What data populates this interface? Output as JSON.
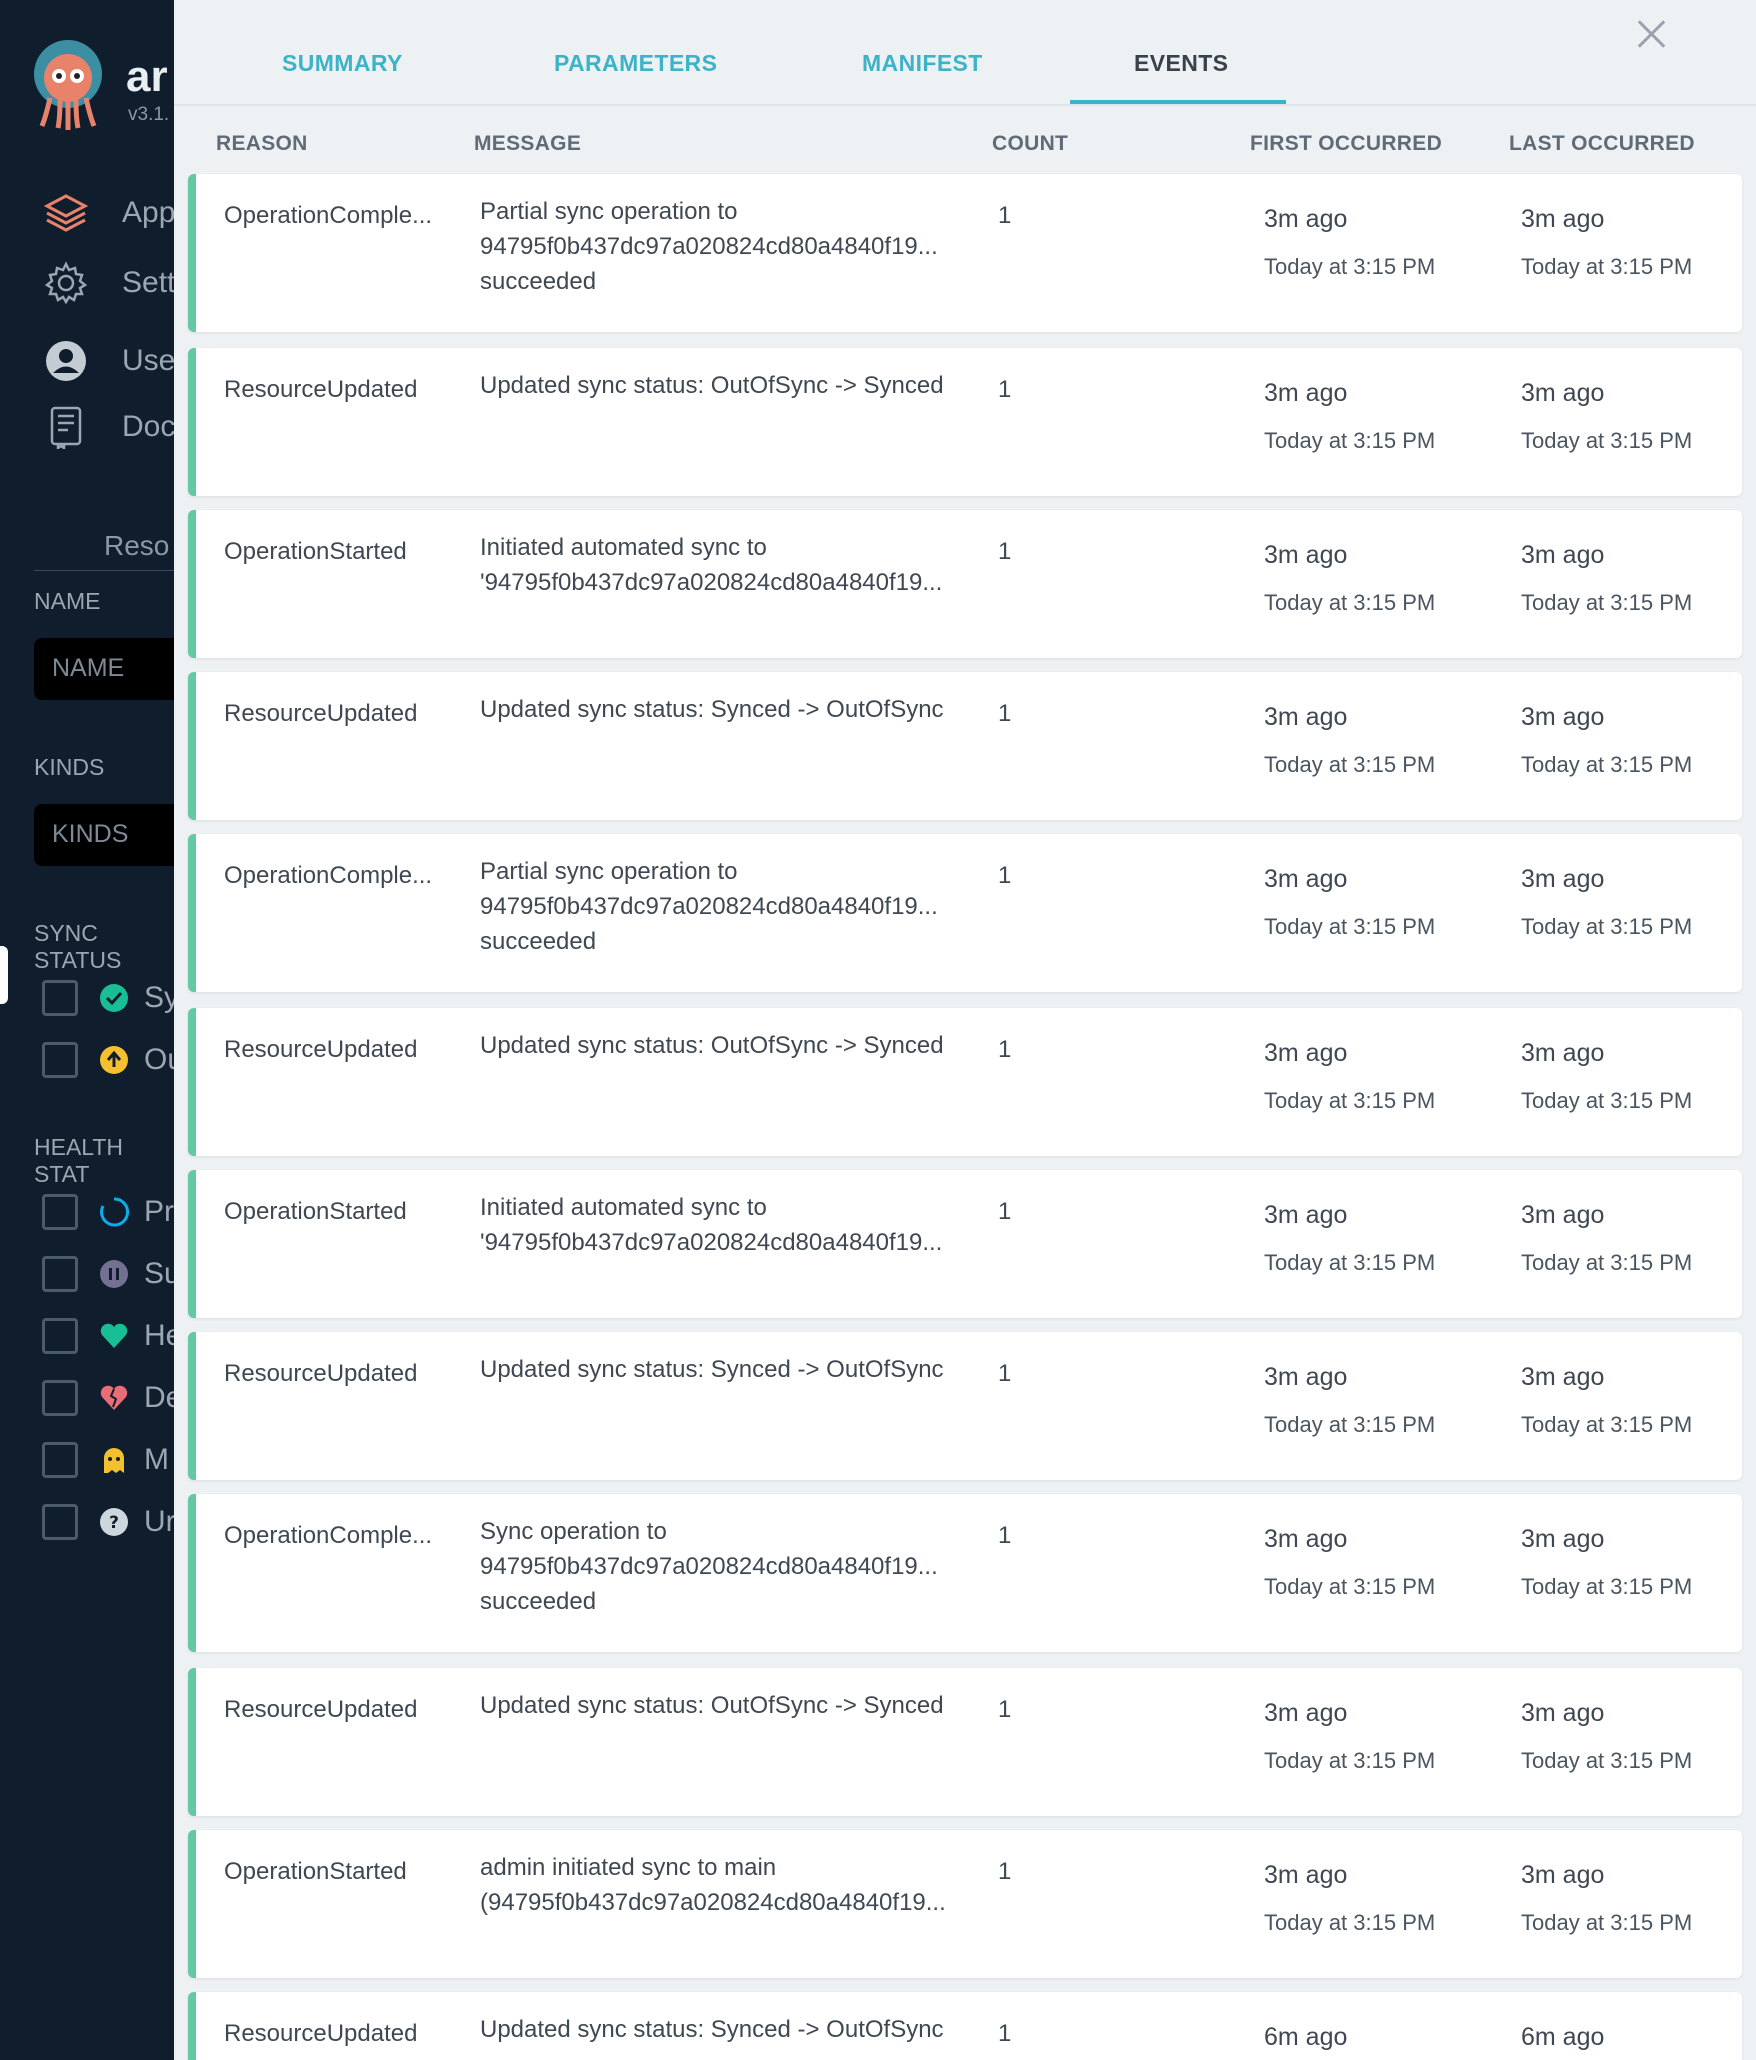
{
  "sidebar": {
    "brand": "ar",
    "version": "v3.1.",
    "nav": [
      {
        "label": "App",
        "icon": "layers-icon"
      },
      {
        "label": "Sett",
        "icon": "gear-icon"
      },
      {
        "label": "Use",
        "icon": "user-icon"
      },
      {
        "label": "Doc",
        "icon": "book-icon"
      }
    ],
    "filters_title": "Reso",
    "name_label": "NAME",
    "name_placeholder": "NAME",
    "kinds_label": "KINDS",
    "kinds_placeholder": "KINDS",
    "sync_status_label": "SYNC STATUS",
    "sync_items": [
      {
        "text": "Sy",
        "icon": "check-circle-icon",
        "color": "#18be94"
      },
      {
        "text": "Ou",
        "icon": "arrow-up-circle-icon",
        "color": "#f4c030"
      }
    ],
    "health_status_label": "HEALTH STAT",
    "health_items": [
      {
        "text": "Pr",
        "icon": "progress-circle-icon",
        "color": "#0dadea"
      },
      {
        "text": "Su",
        "icon": "pause-circle-icon",
        "color": "#766f94"
      },
      {
        "text": "He",
        "icon": "heart-icon",
        "color": "#18be94"
      },
      {
        "text": "De",
        "icon": "broken-heart-icon",
        "color": "#e96d76"
      },
      {
        "text": "M",
        "icon": "ghost-icon",
        "color": "#f4c030"
      },
      {
        "text": "Ur",
        "icon": "question-circle-icon",
        "color": "#ccd6dd"
      }
    ]
  },
  "tabs": {
    "summary": "SUMMARY",
    "parameters": "PARAMETERS",
    "manifest": "MANIFEST",
    "events": "EVENTS"
  },
  "columns": {
    "reason": "REASON",
    "message": "MESSAGE",
    "count": "COUNT",
    "first": "FIRST OCCURRED",
    "last": "LAST OCCURRED"
  },
  "events": [
    {
      "reason": "OperationComple...",
      "message": [
        "Partial sync operation to",
        "94795f0b437dc97a020824cd80a4840f19...",
        "succeeded"
      ],
      "count": "1",
      "first_ago": "3m ago",
      "first_at": "Today at 3:15 PM",
      "last_ago": "3m ago",
      "last_at": "Today at 3:15 PM"
    },
    {
      "reason": "ResourceUpdated",
      "message": [
        "Updated sync status: OutOfSync -> Synced"
      ],
      "count": "1",
      "first_ago": "3m ago",
      "first_at": "Today at 3:15 PM",
      "last_ago": "3m ago",
      "last_at": "Today at 3:15 PM"
    },
    {
      "reason": "OperationStarted",
      "message": [
        "Initiated automated sync to",
        "'94795f0b437dc97a020824cd80a4840f19..."
      ],
      "count": "1",
      "first_ago": "3m ago",
      "first_at": "Today at 3:15 PM",
      "last_ago": "3m ago",
      "last_at": "Today at 3:15 PM"
    },
    {
      "reason": "ResourceUpdated",
      "message": [
        "Updated sync status: Synced -> OutOfSync"
      ],
      "count": "1",
      "first_ago": "3m ago",
      "first_at": "Today at 3:15 PM",
      "last_ago": "3m ago",
      "last_at": "Today at 3:15 PM"
    },
    {
      "reason": "OperationComple...",
      "message": [
        "Partial sync operation to",
        "94795f0b437dc97a020824cd80a4840f19...",
        "succeeded"
      ],
      "count": "1",
      "first_ago": "3m ago",
      "first_at": "Today at 3:15 PM",
      "last_ago": "3m ago",
      "last_at": "Today at 3:15 PM"
    },
    {
      "reason": "ResourceUpdated",
      "message": [
        "Updated sync status: OutOfSync -> Synced"
      ],
      "count": "1",
      "first_ago": "3m ago",
      "first_at": "Today at 3:15 PM",
      "last_ago": "3m ago",
      "last_at": "Today at 3:15 PM"
    },
    {
      "reason": "OperationStarted",
      "message": [
        "Initiated automated sync to",
        "'94795f0b437dc97a020824cd80a4840f19..."
      ],
      "count": "1",
      "first_ago": "3m ago",
      "first_at": "Today at 3:15 PM",
      "last_ago": "3m ago",
      "last_at": "Today at 3:15 PM"
    },
    {
      "reason": "ResourceUpdated",
      "message": [
        "Updated sync status: Synced -> OutOfSync"
      ],
      "count": "1",
      "first_ago": "3m ago",
      "first_at": "Today at 3:15 PM",
      "last_ago": "3m ago",
      "last_at": "Today at 3:15 PM"
    },
    {
      "reason": "OperationComple...",
      "message": [
        "Sync operation to",
        "94795f0b437dc97a020824cd80a4840f19...",
        "succeeded"
      ],
      "count": "1",
      "first_ago": "3m ago",
      "first_at": "Today at 3:15 PM",
      "last_ago": "3m ago",
      "last_at": "Today at 3:15 PM"
    },
    {
      "reason": "ResourceUpdated",
      "message": [
        "Updated sync status: OutOfSync -> Synced"
      ],
      "count": "1",
      "first_ago": "3m ago",
      "first_at": "Today at 3:15 PM",
      "last_ago": "3m ago",
      "last_at": "Today at 3:15 PM"
    },
    {
      "reason": "OperationStarted",
      "message": [
        "admin initiated sync to main",
        "(94795f0b437dc97a020824cd80a4840f19..."
      ],
      "count": "1",
      "first_ago": "3m ago",
      "first_at": "Today at 3:15 PM",
      "last_ago": "3m ago",
      "last_at": "Today at 3:15 PM"
    },
    {
      "reason": "ResourceUpdated",
      "message": [
        "Updated sync status: Synced -> OutOfSync"
      ],
      "count": "1",
      "first_ago": "6m ago",
      "first_at": "",
      "last_ago": "6m ago",
      "last_at": ""
    }
  ],
  "colors": {
    "accent": "#3cb3c8",
    "row_border": "#64c9a3",
    "sidebar_bg": "#0f1d2c",
    "panel_bg": "#eef1f4"
  }
}
